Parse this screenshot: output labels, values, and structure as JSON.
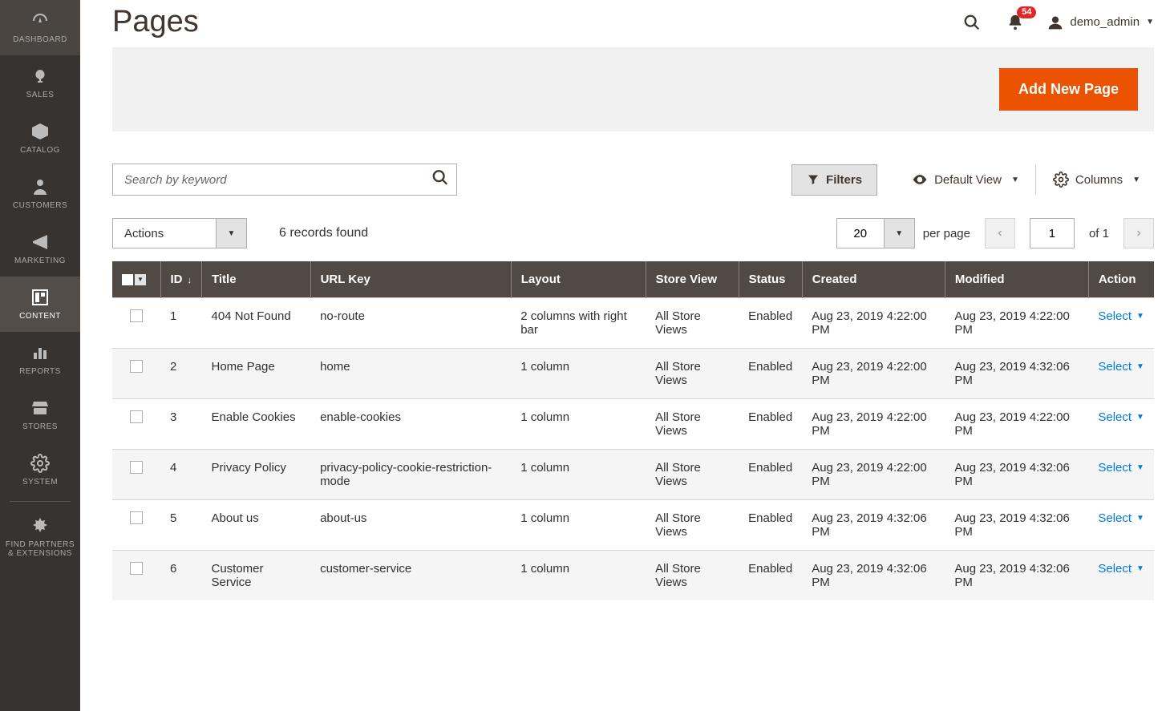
{
  "sidebar": [
    {
      "label": "DASHBOARD",
      "name": "sidebar-item-dashboard",
      "active": false
    },
    {
      "label": "SALES",
      "name": "sidebar-item-sales",
      "active": false
    },
    {
      "label": "CATALOG",
      "name": "sidebar-item-catalog",
      "active": false
    },
    {
      "label": "CUSTOMERS",
      "name": "sidebar-item-customers",
      "active": false
    },
    {
      "label": "MARKETING",
      "name": "sidebar-item-marketing",
      "active": false
    },
    {
      "label": "CONTENT",
      "name": "sidebar-item-content",
      "active": true
    },
    {
      "label": "REPORTS",
      "name": "sidebar-item-reports",
      "active": false
    },
    {
      "label": "STORES",
      "name": "sidebar-item-stores",
      "active": false
    },
    {
      "label": "SYSTEM",
      "name": "sidebar-item-system",
      "active": false
    },
    {
      "label": "FIND PARTNERS & EXTENSIONS",
      "name": "sidebar-item-partners",
      "active": false
    }
  ],
  "page": {
    "title": "Pages",
    "add_button": "Add New Page"
  },
  "header": {
    "notifications": "54",
    "username": "demo_admin"
  },
  "toolbar": {
    "search_placeholder": "Search by keyword",
    "filters": "Filters",
    "default_view": "Default View",
    "columns": "Columns",
    "actions_label": "Actions",
    "records_found": "6 records found",
    "per_page_value": "20",
    "per_page_label": "per page",
    "page_current": "1",
    "page_total": "of 1"
  },
  "grid": {
    "columns": {
      "id": "ID",
      "title": "Title",
      "url_key": "URL Key",
      "layout": "Layout",
      "store_view": "Store View",
      "status": "Status",
      "created": "Created",
      "modified": "Modified",
      "action": "Action"
    },
    "action_select_label": "Select",
    "rows": [
      {
        "id": "1",
        "title": "404 Not Found",
        "url_key": "no-route",
        "layout": "2 columns with right bar",
        "store_view": "All Store Views",
        "status": "Enabled",
        "created": "Aug 23, 2019 4:22:00 PM",
        "modified": "Aug 23, 2019 4:22:00 PM"
      },
      {
        "id": "2",
        "title": "Home Page",
        "url_key": "home",
        "layout": "1 column",
        "store_view": "All Store Views",
        "status": "Enabled",
        "created": "Aug 23, 2019 4:22:00 PM",
        "modified": "Aug 23, 2019 4:32:06 PM"
      },
      {
        "id": "3",
        "title": "Enable Cookies",
        "url_key": "enable-cookies",
        "layout": "1 column",
        "store_view": "All Store Views",
        "status": "Enabled",
        "created": "Aug 23, 2019 4:22:00 PM",
        "modified": "Aug 23, 2019 4:22:00 PM"
      },
      {
        "id": "4",
        "title": "Privacy Policy",
        "url_key": "privacy-policy-cookie-restriction-mode",
        "layout": "1 column",
        "store_view": "All Store Views",
        "status": "Enabled",
        "created": "Aug 23, 2019 4:22:00 PM",
        "modified": "Aug 23, 2019 4:32:06 PM"
      },
      {
        "id": "5",
        "title": "About us",
        "url_key": "about-us",
        "layout": "1 column",
        "store_view": "All Store Views",
        "status": "Enabled",
        "created": "Aug 23, 2019 4:32:06 PM",
        "modified": "Aug 23, 2019 4:32:06 PM"
      },
      {
        "id": "6",
        "title": "Customer Service",
        "url_key": "customer-service",
        "layout": "1 column",
        "store_view": "All Store Views",
        "status": "Enabled",
        "created": "Aug 23, 2019 4:32:06 PM",
        "modified": "Aug 23, 2019 4:32:06 PM"
      }
    ]
  }
}
